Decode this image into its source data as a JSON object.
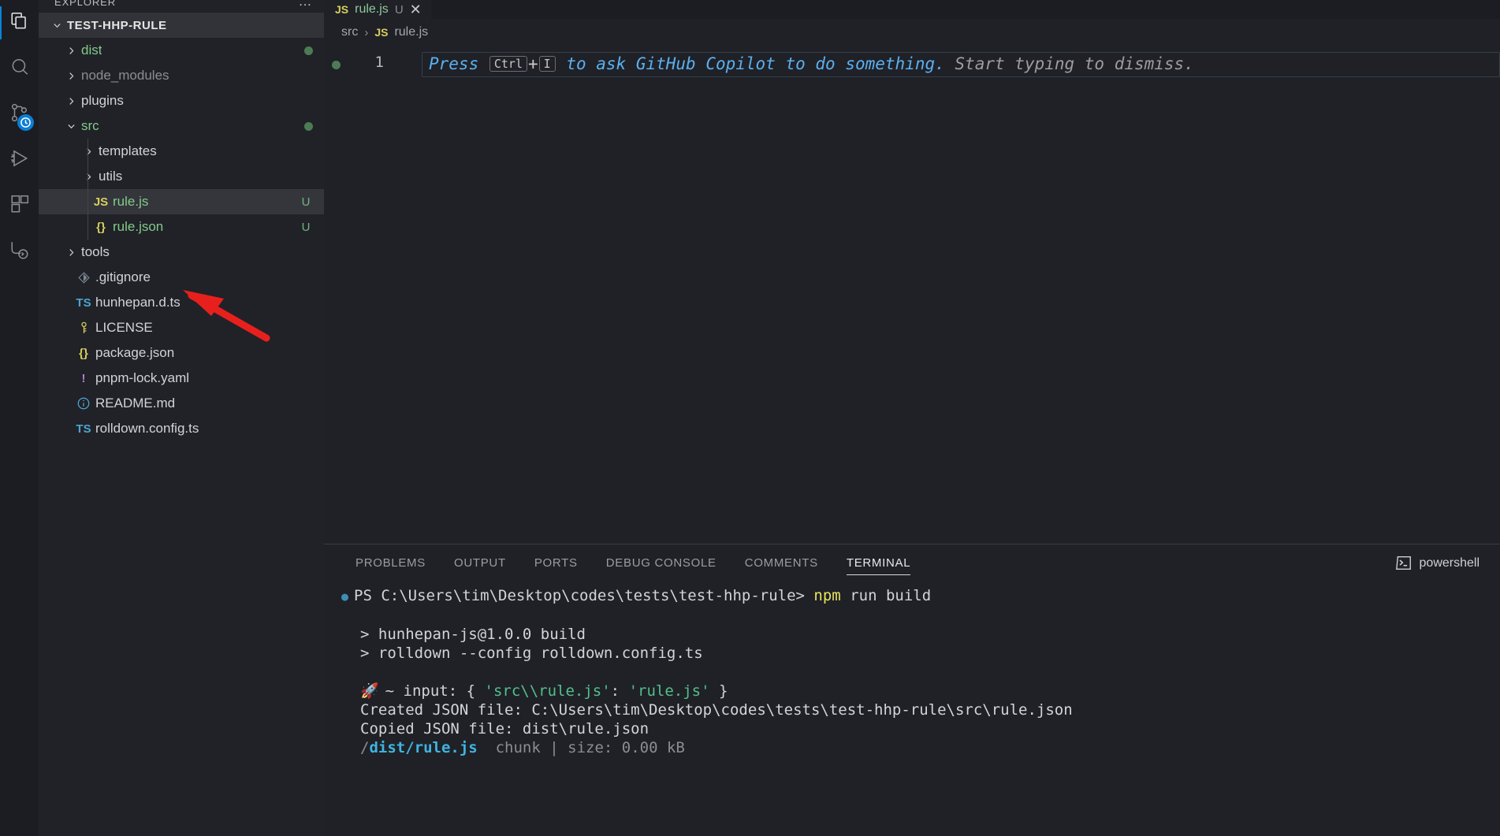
{
  "activitybar": {
    "items": [
      {
        "name": "explorer",
        "icon": "files-icon",
        "active": true
      },
      {
        "name": "search",
        "icon": "search-icon",
        "active": false
      },
      {
        "name": "source-control",
        "icon": "source-control-icon",
        "badge": "clock-icon",
        "active": false
      },
      {
        "name": "run-and-debug",
        "icon": "run-debug-icon",
        "active": false
      },
      {
        "name": "extensions",
        "icon": "extensions-icon",
        "active": false
      },
      {
        "name": "remote-explorer",
        "icon": "remote-icon",
        "active": false
      }
    ]
  },
  "sidebar": {
    "title": "EXPLORER",
    "more_label": "…",
    "root": {
      "label": "TEST-HHP-RULE",
      "expanded": true
    },
    "tree": [
      {
        "label": "dist",
        "type": "folder",
        "depth": 1,
        "expanded": false,
        "color": "green",
        "dot": true
      },
      {
        "label": "node_modules",
        "type": "folder",
        "depth": 1,
        "expanded": false,
        "color": "dim",
        "dot": false
      },
      {
        "label": "plugins",
        "type": "folder",
        "depth": 1,
        "expanded": false,
        "color": "white",
        "dot": false
      },
      {
        "label": "src",
        "type": "folder",
        "depth": 1,
        "expanded": true,
        "color": "green",
        "dot": true
      },
      {
        "label": "templates",
        "type": "folder",
        "depth": 2,
        "expanded": false,
        "color": "white",
        "dot": false
      },
      {
        "label": "utils",
        "type": "folder",
        "depth": 2,
        "expanded": false,
        "color": "white",
        "dot": false
      },
      {
        "label": "rule.js",
        "type": "file",
        "depth": 2,
        "icon": "JS",
        "icon_color": "yellow",
        "color": "green",
        "badge": "U",
        "selected": true
      },
      {
        "label": "rule.json",
        "type": "file",
        "depth": 2,
        "icon": "{}",
        "icon_color": "yellow",
        "color": "green",
        "badge": "U",
        "selected": false
      },
      {
        "label": "tools",
        "type": "folder",
        "depth": 1,
        "expanded": false,
        "color": "white",
        "dot": false
      },
      {
        "label": ".gitignore",
        "type": "file",
        "depth": 1,
        "icon": "git",
        "icon_color": "slate",
        "color": "white"
      },
      {
        "label": "hunhepan.d.ts",
        "type": "file",
        "depth": 1,
        "icon": "TS",
        "icon_color": "blue",
        "color": "white"
      },
      {
        "label": "LICENSE",
        "type": "file",
        "depth": 1,
        "icon": "key",
        "icon_color": "yellow",
        "color": "white"
      },
      {
        "label": "package.json",
        "type": "file",
        "depth": 1,
        "icon": "{}",
        "icon_color": "yellow",
        "color": "white"
      },
      {
        "label": "pnpm-lock.yaml",
        "type": "file",
        "depth": 1,
        "icon": "!",
        "icon_color": "purple",
        "color": "white"
      },
      {
        "label": "README.md",
        "type": "file",
        "depth": 1,
        "icon": "info",
        "icon_color": "blue",
        "color": "white"
      },
      {
        "label": "rolldown.config.ts",
        "type": "file",
        "depth": 1,
        "icon": "TS",
        "icon_color": "blue",
        "color": "white"
      }
    ]
  },
  "editor": {
    "tab": {
      "icon": "JS",
      "label": "rule.js",
      "dirty_marker": "U",
      "close_label": "✕"
    },
    "breadcrumb": {
      "folder": "src",
      "separator": "›",
      "file_icon": "JS",
      "file": "rule.js"
    },
    "line_number": "1",
    "hint": {
      "prefix": "Press ",
      "key1": "Ctrl",
      "plus": "+",
      "key2": "I",
      "middle": " to ask GitHub Copilot to do something.",
      "suffix": " Start typing to dismiss."
    }
  },
  "panel": {
    "tabs": [
      {
        "label": "PROBLEMS",
        "active": false
      },
      {
        "label": "OUTPUT",
        "active": false
      },
      {
        "label": "PORTS",
        "active": false
      },
      {
        "label": "DEBUG CONSOLE",
        "active": false
      },
      {
        "label": "COMMENTS",
        "active": false
      },
      {
        "label": "TERMINAL",
        "active": true
      }
    ],
    "shell": {
      "icon": "terminal-icon",
      "label": "powershell"
    },
    "terminal_lines": [
      {
        "type": "prompt",
        "bullet": "●",
        "text": "PS C:\\Users\\tim\\Desktop\\codes\\tests\\test-hhp-rule> ",
        "command": "npm",
        "args": " run build"
      },
      {
        "type": "blank"
      },
      {
        "type": "plain",
        "text": "> hunhepan-js@1.0.0 build"
      },
      {
        "type": "plain",
        "text": "> rolldown --config rolldown.config.ts"
      },
      {
        "type": "blank"
      },
      {
        "type": "rocket",
        "icon": "🚀",
        "pre": "~ input: { ",
        "q1": "'src\\\\rule.js'",
        "mid": ": ",
        "q2": "'rule.js'",
        "post": " }"
      },
      {
        "type": "plain",
        "text": "Created JSON file: C:\\Users\\tim\\Desktop\\codes\\tests\\test-hhp-rule\\src\\rule.json"
      },
      {
        "type": "plain",
        "text": "Copied JSON file: dist\\rule.json"
      },
      {
        "type": "chunk",
        "dir": "<DIR>/",
        "file": "dist/rule.js",
        "meta": "  chunk | size: 0.00 kB"
      }
    ]
  },
  "annotation": {
    "type": "arrow",
    "color": "#e8201d",
    "points_to": "rule.json"
  }
}
